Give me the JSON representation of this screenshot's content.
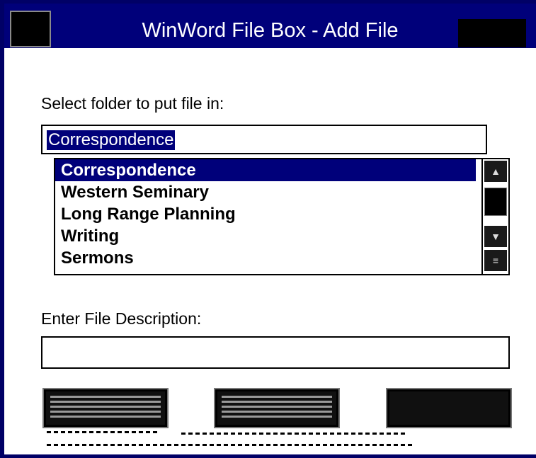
{
  "window": {
    "title": "WinWord File Box - Add File"
  },
  "folder_label": "Select folder to put file in:",
  "folder_combo": {
    "value": "Correspondence"
  },
  "folders": [
    {
      "label": "Correspondence",
      "selected": true
    },
    {
      "label": "Western Seminary",
      "selected": false
    },
    {
      "label": "Long Range Planning",
      "selected": false
    },
    {
      "label": "Writing",
      "selected": false
    },
    {
      "label": "Sermons",
      "selected": false
    }
  ],
  "description_label": "Enter File Description:",
  "description_input": {
    "value": ""
  },
  "colors": {
    "title_bar": "#00007a",
    "selection": "#00007a",
    "frame": "#000066"
  }
}
